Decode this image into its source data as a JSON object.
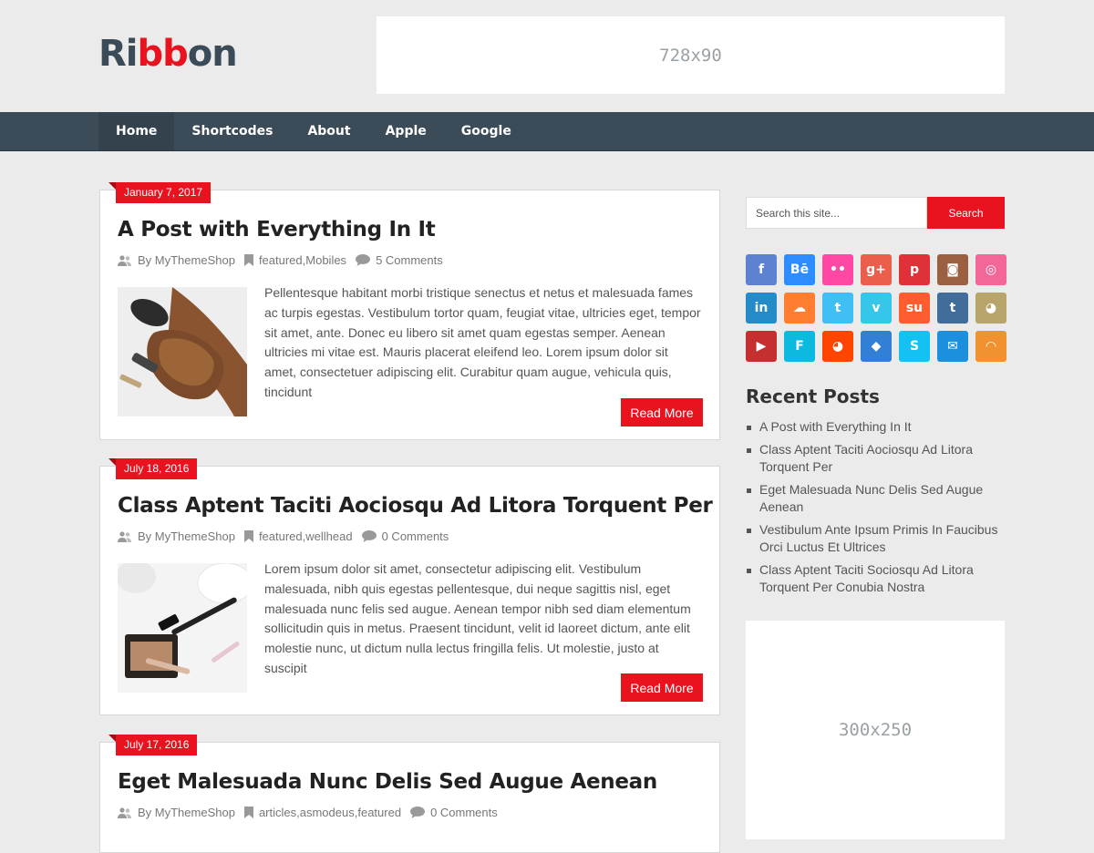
{
  "site": {
    "logo_pre": "Ri",
    "logo_red": "bb",
    "logo_post": "on"
  },
  "ad_top": "728x90",
  "ad_side": "300x250",
  "nav": [
    "Home",
    "Shortcodes",
    "About",
    "Apple",
    "Google"
  ],
  "posts": [
    {
      "date": "January 7, 2017",
      "title": "A Post with Everything In It",
      "author": "By MyThemeShop",
      "category_1": "featured",
      "category_2": "Mobiles",
      "comments": "5 Comments",
      "excerpt": "Pellentesque habitant morbi tristique senectus et netus et malesuada fames ac turpis egestas. Vestibulum tortor quam, feugiat vitae, ultricies eget, tempor sit amet, ante. Donec eu libero sit amet quam egestas semper. Aenean ultricies mi vitae est. Mauris placerat eleifend leo. Lorem ipsum dolor sit amet, consectetuer adipiscing elit. Curabitur quam augue, vehicula quis, tincidunt",
      "read_more": "Read More"
    },
    {
      "date": "July 18, 2016",
      "title": "Class Aptent Taciti Aociosqu Ad Litora Torquent Per",
      "author": "By MyThemeShop",
      "category_1": "featured",
      "category_2": "wellhead",
      "comments": "0 Comments",
      "excerpt": "Lorem ipsum dolor sit amet, consectetur adipiscing elit. Vestibulum malesuada, nibh quis egestas pellentesque, dui neque sagittis nisl, eget malesuada nunc felis sed augue. Aenean tempor nibh sed diam elementum sollicitudin quis in metus. Praesent tincidunt, velit id laoreet dictum, ante elit molestie nunc, ut dictum nulla lectus fringilla felis. Ut molestie, justo at suscipit",
      "read_more": "Read More"
    },
    {
      "date": "July 17, 2016",
      "title": "Eget Malesuada Nunc Delis Sed Augue Aenean",
      "author": "By MyThemeShop",
      "category_1": "articles",
      "category_2": "asmodeus",
      "category_3": "featured",
      "comments": "0 Comments"
    }
  ],
  "search": {
    "placeholder": "Search this site...",
    "button": "Search"
  },
  "social_icons": [
    {
      "name": "facebook",
      "glyph": "f",
      "color": "#5d82d1"
    },
    {
      "name": "behance",
      "glyph": "Bē",
      "color": "#2d8cff"
    },
    {
      "name": "flickr",
      "glyph": "••",
      "color": "#ff48a3"
    },
    {
      "name": "google-plus",
      "glyph": "g+",
      "color": "#eb5e4c"
    },
    {
      "name": "pinterest",
      "glyph": "p",
      "color": "#e13138"
    },
    {
      "name": "instagram",
      "glyph": "◙",
      "color": "#9b5f41"
    },
    {
      "name": "dribbble",
      "glyph": "◎",
      "color": "#f26798"
    },
    {
      "name": "linkedin",
      "glyph": "in",
      "color": "#238cc8"
    },
    {
      "name": "soundcloud",
      "glyph": "☁",
      "color": "#ff7e30"
    },
    {
      "name": "twitter",
      "glyph": "t",
      "color": "#40bff5"
    },
    {
      "name": "vimeo",
      "glyph": "v",
      "color": "#35c6ea"
    },
    {
      "name": "stumbleupon",
      "glyph": "su",
      "color": "#ff5c30"
    },
    {
      "name": "tumblr",
      "glyph": "t",
      "color": "#426d9b"
    },
    {
      "name": "github",
      "glyph": "◕",
      "color": "#b8a56c"
    },
    {
      "name": "youtube",
      "glyph": "▶",
      "color": "#c52f30"
    },
    {
      "name": "foursquare",
      "glyph": "F",
      "color": "#0cbadf"
    },
    {
      "name": "reddit",
      "glyph": "◕",
      "color": "#ff4500"
    },
    {
      "name": "dropbox",
      "glyph": "◆",
      "color": "#3180d5"
    },
    {
      "name": "skype",
      "glyph": "S",
      "color": "#13c1f3"
    },
    {
      "name": "email",
      "glyph": "✉",
      "color": "#1d90dd"
    },
    {
      "name": "rss",
      "glyph": "◠",
      "color": "#ef922f"
    }
  ],
  "recent_posts": {
    "title": "Recent Posts",
    "items": [
      "A Post with Everything In It",
      "Class Aptent Taciti Aociosqu Ad Litora Torquent Per",
      "Eget Malesuada Nunc Delis Sed Augue Aenean",
      "Vestibulum Ante Ipsum Primis In Faucibus Orci Luctus Et Ultrices",
      "Class Aptent Taciti Sociosqu Ad Litora Torquent Per Conubia Nostra"
    ]
  }
}
